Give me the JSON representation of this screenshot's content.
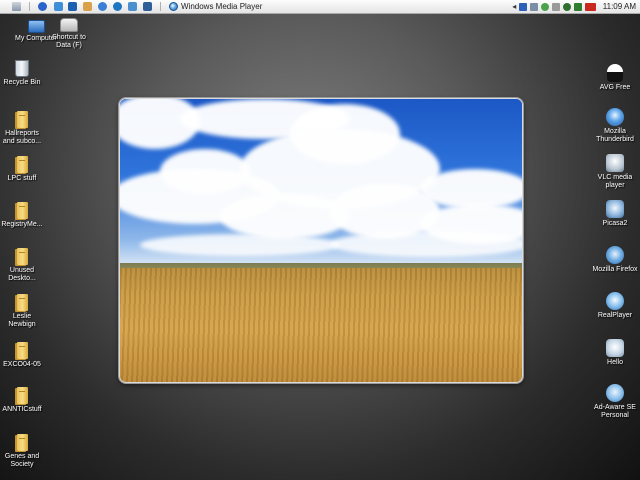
{
  "taskbar": {
    "active_window": "Windows Media Player",
    "clock": "11:09 AM",
    "tray_chevron": "◂"
  },
  "desktop_left": [
    {
      "label": "My Computer",
      "icon": "my-computer-icon"
    },
    {
      "label": "Shortcut to Data (F)",
      "icon": "drive-icon"
    },
    {
      "label": "Recycle Bin",
      "icon": "recycle-bin-icon"
    },
    {
      "label": "Hallreports and subco...",
      "icon": "folder-icon"
    },
    {
      "label": "LPC stuff",
      "icon": "folder-icon"
    },
    {
      "label": "RegistryMe...",
      "icon": "folder-icon"
    },
    {
      "label": "Unused Deskto...",
      "icon": "folder-icon"
    },
    {
      "label": "Leslie Newbign",
      "icon": "folder-icon"
    },
    {
      "label": "EXCO04-05",
      "icon": "folder-icon"
    },
    {
      "label": "ANNTICstuff",
      "icon": "folder-icon"
    },
    {
      "label": "Genes and Society",
      "icon": "folder-icon"
    }
  ],
  "desktop_right": [
    {
      "label": "AVG Free",
      "icon": "avg-icon"
    },
    {
      "label": "Mozilla Thunderbird",
      "icon": "thunderbird-icon"
    },
    {
      "label": "VLC media player",
      "icon": "vlc-icon"
    },
    {
      "label": "Picasa2",
      "icon": "picasa-icon"
    },
    {
      "label": "Mozilla Firefox",
      "icon": "firefox-icon"
    },
    {
      "label": "RealPlayer",
      "icon": "realplayer-icon"
    },
    {
      "label": "Hello",
      "icon": "hello-icon"
    },
    {
      "label": "Ad-Aware SE Personal",
      "icon": "adaware-icon"
    }
  ]
}
